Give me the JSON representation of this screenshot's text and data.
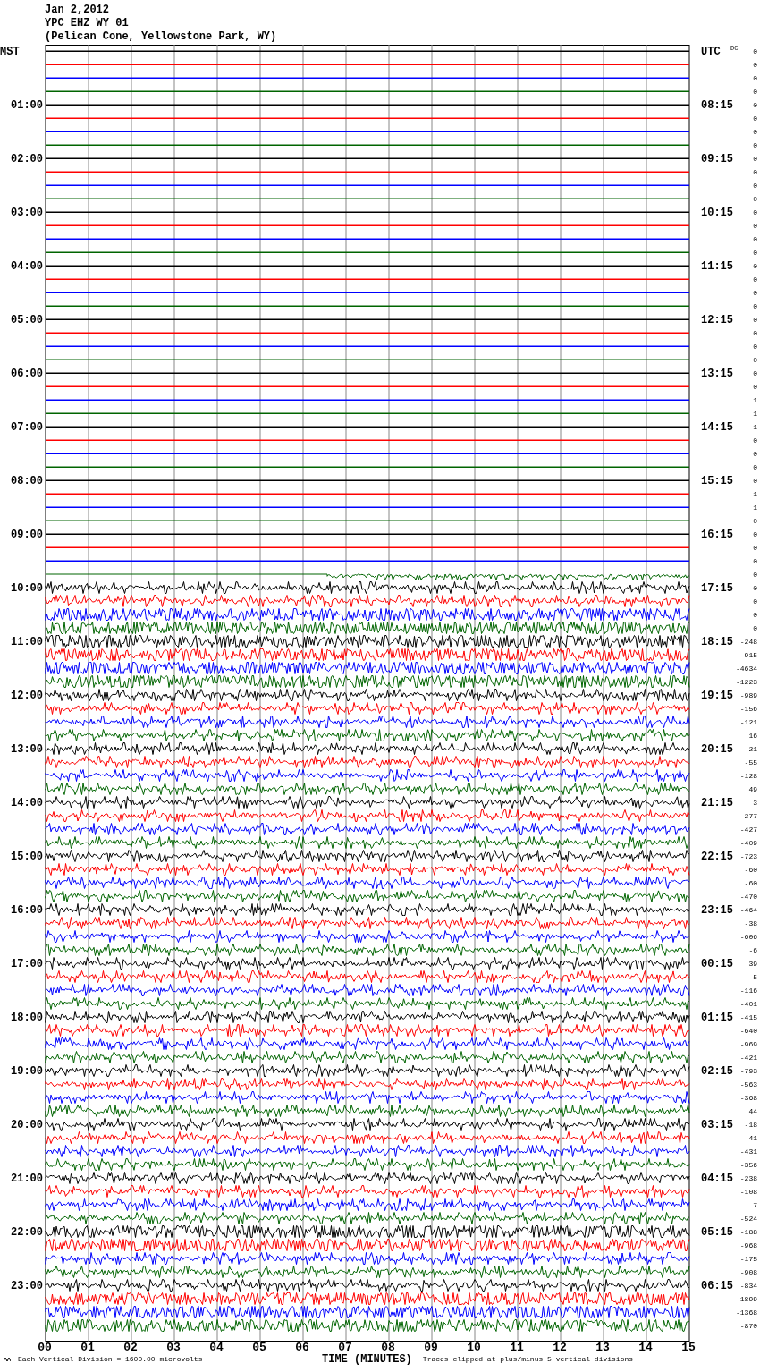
{
  "header": {
    "date": "Jan 2,2012",
    "station": "YPC EHZ WY 01",
    "location": "(Pelican Cone, Yellowstone Park, WY)"
  },
  "left_axis": {
    "title": "MST"
  },
  "right_axis": {
    "title": "UTC",
    "dc_title": "DC"
  },
  "rows": [
    {
      "dc": "0",
      "color": "#000000",
      "kind": "flat"
    },
    {
      "dc": "0",
      "color": "#ff0000",
      "kind": "flat"
    },
    {
      "dc": "0",
      "color": "#0000ff",
      "kind": "flat"
    },
    {
      "dc": "0",
      "color": "#006400",
      "kind": "flat"
    },
    {
      "mst": "01:00",
      "utc": "08:15",
      "dc": "0",
      "color": "#000000",
      "kind": "flat"
    },
    {
      "dc": "0",
      "color": "#ff0000",
      "kind": "flat"
    },
    {
      "dc": "0",
      "color": "#0000ff",
      "kind": "flat"
    },
    {
      "dc": "0",
      "color": "#006400",
      "kind": "flat"
    },
    {
      "mst": "02:00",
      "utc": "09:15",
      "dc": "0",
      "color": "#000000",
      "kind": "flat"
    },
    {
      "dc": "0",
      "color": "#ff0000",
      "kind": "flat"
    },
    {
      "dc": "0",
      "color": "#0000ff",
      "kind": "flat"
    },
    {
      "dc": "0",
      "color": "#006400",
      "kind": "flat"
    },
    {
      "mst": "03:00",
      "utc": "10:15",
      "dc": "0",
      "color": "#000000",
      "kind": "flat"
    },
    {
      "dc": "0",
      "color": "#ff0000",
      "kind": "flat"
    },
    {
      "dc": "0",
      "color": "#0000ff",
      "kind": "flat"
    },
    {
      "dc": "0",
      "color": "#006400",
      "kind": "flat"
    },
    {
      "mst": "04:00",
      "utc": "11:15",
      "dc": "0",
      "color": "#000000",
      "kind": "flat"
    },
    {
      "dc": "0",
      "color": "#ff0000",
      "kind": "flat"
    },
    {
      "dc": "0",
      "color": "#0000ff",
      "kind": "flat"
    },
    {
      "dc": "0",
      "color": "#006400",
      "kind": "flat"
    },
    {
      "mst": "05:00",
      "utc": "12:15",
      "dc": "0",
      "color": "#000000",
      "kind": "flat"
    },
    {
      "dc": "0",
      "color": "#ff0000",
      "kind": "flat"
    },
    {
      "dc": "0",
      "color": "#0000ff",
      "kind": "flat"
    },
    {
      "dc": "0",
      "color": "#006400",
      "kind": "flat"
    },
    {
      "mst": "06:00",
      "utc": "13:15",
      "dc": "0",
      "color": "#000000",
      "kind": "flat"
    },
    {
      "dc": "0",
      "color": "#ff0000",
      "kind": "flat"
    },
    {
      "dc": "1",
      "color": "#0000ff",
      "kind": "flat"
    },
    {
      "dc": "1",
      "color": "#006400",
      "kind": "flat"
    },
    {
      "mst": "07:00",
      "utc": "14:15",
      "dc": "1",
      "color": "#000000",
      "kind": "flat"
    },
    {
      "dc": "0",
      "color": "#ff0000",
      "kind": "flat"
    },
    {
      "dc": "0",
      "color": "#0000ff",
      "kind": "flat"
    },
    {
      "dc": "0",
      "color": "#006400",
      "kind": "flat"
    },
    {
      "mst": "08:00",
      "utc": "15:15",
      "dc": "0",
      "color": "#000000",
      "kind": "flat"
    },
    {
      "dc": "1",
      "color": "#ff0000",
      "kind": "flat"
    },
    {
      "dc": "1",
      "color": "#0000ff",
      "kind": "flat"
    },
    {
      "dc": "0",
      "color": "#006400",
      "kind": "flat"
    },
    {
      "mst": "09:00",
      "utc": "16:15",
      "dc": "0",
      "color": "#000000",
      "kind": "flat"
    },
    {
      "dc": "0",
      "color": "#ff0000",
      "kind": "flat"
    },
    {
      "dc": "0",
      "color": "#0000ff",
      "kind": "flat"
    },
    {
      "dc": "0",
      "color": "#006400",
      "kind": "partial"
    },
    {
      "mst": "10:00",
      "utc": "17:15",
      "dc": "0",
      "color": "#000000",
      "kind": "signal"
    },
    {
      "dc": "0",
      "color": "#ff0000",
      "kind": "signal"
    },
    {
      "dc": "0",
      "color": "#0000ff",
      "kind": "strong"
    },
    {
      "dc": "0",
      "color": "#006400",
      "kind": "strong"
    },
    {
      "mst": "11:00",
      "utc": "18:15",
      "dc": "-248",
      "color": "#000000",
      "kind": "strong"
    },
    {
      "dc": "-915",
      "color": "#ff0000",
      "kind": "strong"
    },
    {
      "dc": "-4634",
      "color": "#0000ff",
      "kind": "strong"
    },
    {
      "dc": "-1223",
      "color": "#006400",
      "kind": "strong"
    },
    {
      "mst": "12:00",
      "utc": "19:15",
      "dc": "-989",
      "color": "#000000",
      "kind": "signal"
    },
    {
      "dc": "-156",
      "color": "#ff0000",
      "kind": "signal"
    },
    {
      "dc": "-121",
      "color": "#0000ff",
      "kind": "signal"
    },
    {
      "dc": "16",
      "color": "#006400",
      "kind": "signal"
    },
    {
      "mst": "13:00",
      "utc": "20:15",
      "dc": "-21",
      "color": "#000000",
      "kind": "signal"
    },
    {
      "dc": "-55",
      "color": "#ff0000",
      "kind": "signal"
    },
    {
      "dc": "-128",
      "color": "#0000ff",
      "kind": "signal"
    },
    {
      "dc": "49",
      "color": "#006400",
      "kind": "signal"
    },
    {
      "mst": "14:00",
      "utc": "21:15",
      "dc": "3",
      "color": "#000000",
      "kind": "signal"
    },
    {
      "dc": "-277",
      "color": "#ff0000",
      "kind": "signal"
    },
    {
      "dc": "-427",
      "color": "#0000ff",
      "kind": "signal"
    },
    {
      "dc": "-409",
      "color": "#006400",
      "kind": "signal"
    },
    {
      "mst": "15:00",
      "utc": "22:15",
      "dc": "-723",
      "color": "#000000",
      "kind": "signal"
    },
    {
      "dc": "-60",
      "color": "#ff0000",
      "kind": "signal"
    },
    {
      "dc": "-60",
      "color": "#0000ff",
      "kind": "signal"
    },
    {
      "dc": "-470",
      "color": "#006400",
      "kind": "signal"
    },
    {
      "mst": "16:00",
      "utc": "23:15",
      "dc": "-464",
      "color": "#000000",
      "kind": "signal"
    },
    {
      "dc": "-38",
      "color": "#ff0000",
      "kind": "signal"
    },
    {
      "dc": "-606",
      "color": "#0000ff",
      "kind": "signal"
    },
    {
      "dc": "-6",
      "color": "#006400",
      "kind": "signal"
    },
    {
      "mst": "17:00",
      "utc": "00:15",
      "dc": "39",
      "color": "#000000",
      "kind": "signal"
    },
    {
      "dc": "5",
      "color": "#ff0000",
      "kind": "signal"
    },
    {
      "dc": "-116",
      "color": "#0000ff",
      "kind": "signal"
    },
    {
      "dc": "-401",
      "color": "#006400",
      "kind": "signal"
    },
    {
      "mst": "18:00",
      "utc": "01:15",
      "dc": "-415",
      "color": "#000000",
      "kind": "signal"
    },
    {
      "dc": "-640",
      "color": "#ff0000",
      "kind": "signal"
    },
    {
      "dc": "-969",
      "color": "#0000ff",
      "kind": "signal"
    },
    {
      "dc": "-421",
      "color": "#006400",
      "kind": "signal"
    },
    {
      "mst": "19:00",
      "utc": "02:15",
      "dc": "-793",
      "color": "#000000",
      "kind": "signal"
    },
    {
      "dc": "-563",
      "color": "#ff0000",
      "kind": "signal"
    },
    {
      "dc": "-368",
      "color": "#0000ff",
      "kind": "signal"
    },
    {
      "dc": "44",
      "color": "#006400",
      "kind": "signal"
    },
    {
      "mst": "20:00",
      "utc": "03:15",
      "dc": "-18",
      "color": "#000000",
      "kind": "signal"
    },
    {
      "dc": "41",
      "color": "#ff0000",
      "kind": "signal"
    },
    {
      "dc": "-431",
      "color": "#0000ff",
      "kind": "signal"
    },
    {
      "dc": "-356",
      "color": "#006400",
      "kind": "signal"
    },
    {
      "mst": "21:00",
      "utc": "04:15",
      "dc": "-238",
      "color": "#000000",
      "kind": "signal"
    },
    {
      "dc": "-108",
      "color": "#ff0000",
      "kind": "signal"
    },
    {
      "dc": "7",
      "color": "#0000ff",
      "kind": "signal"
    },
    {
      "dc": "-524",
      "color": "#006400",
      "kind": "signal"
    },
    {
      "mst": "22:00",
      "utc": "05:15",
      "dc": "-188",
      "color": "#000000",
      "kind": "strong"
    },
    {
      "dc": "-968",
      "color": "#ff0000",
      "kind": "strong"
    },
    {
      "dc": "-175",
      "color": "#0000ff",
      "kind": "signal"
    },
    {
      "dc": "-908",
      "color": "#006400",
      "kind": "signal"
    },
    {
      "mst": "23:00",
      "utc": "06:15",
      "dc": "-834",
      "color": "#000000",
      "kind": "signal"
    },
    {
      "dc": "-1899",
      "color": "#ff0000",
      "kind": "strong"
    },
    {
      "dc": "-1368",
      "color": "#0000ff",
      "kind": "strong"
    },
    {
      "dc": "-870",
      "color": "#006400",
      "kind": "strong"
    }
  ],
  "x_axis": {
    "ticks": [
      "00",
      "01",
      "02",
      "03",
      "04",
      "05",
      "06",
      "07",
      "08",
      "09",
      "10",
      "11",
      "12",
      "13",
      "14",
      "15"
    ],
    "label": "TIME (MINUTES)"
  },
  "footer": {
    "scale_note": "Each Vertical Division = 1600.00 microvolts",
    "clip_note": "Traces clipped at plus/minus 5 vertical divisions"
  }
}
